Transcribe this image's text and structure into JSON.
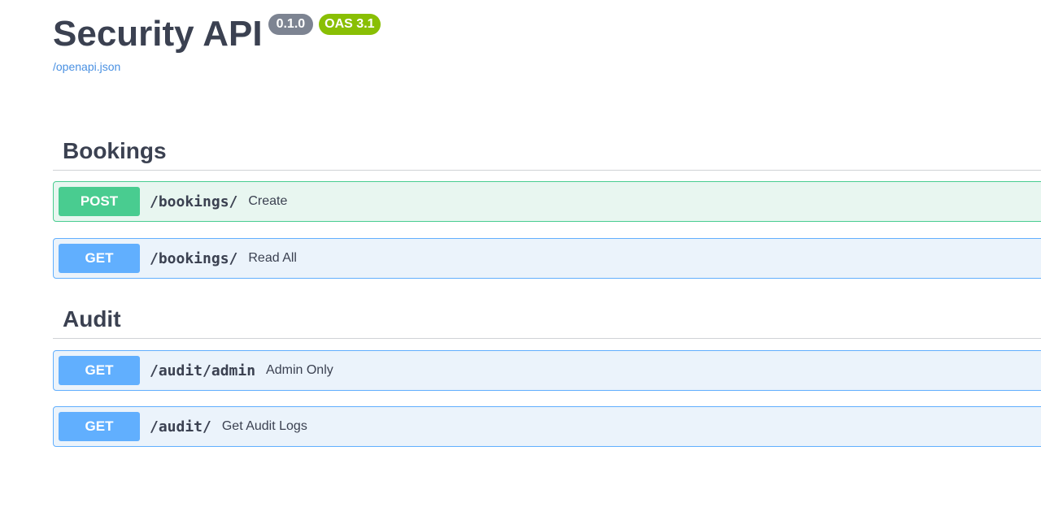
{
  "info": {
    "title": "Security API",
    "version": "0.1.0",
    "oas": "OAS 3.1",
    "spec_link": "/openapi.json"
  },
  "sections": [
    {
      "name": "Bookings",
      "operations": [
        {
          "method": "POST",
          "path": "/bookings/",
          "summary": "Create"
        },
        {
          "method": "GET",
          "path": "/bookings/",
          "summary": "Read All"
        }
      ]
    },
    {
      "name": "Audit",
      "operations": [
        {
          "method": "GET",
          "path": "/audit/admin",
          "summary": "Admin Only"
        },
        {
          "method": "GET",
          "path": "/audit/",
          "summary": "Get Audit Logs"
        }
      ]
    }
  ],
  "colors": {
    "post": "#49cc90",
    "get": "#61affe",
    "version_badge": "#7d8492",
    "oas_badge": "#89bf04",
    "link": "#4990e2"
  }
}
